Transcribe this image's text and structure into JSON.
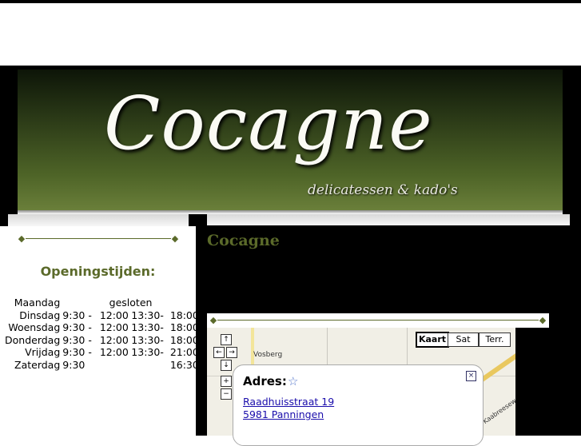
{
  "header": {
    "logo_text": "Cocagne",
    "tagline": "delicatessen & kado's"
  },
  "sidebar": {
    "hours_title": "Openingstijden:",
    "hours": [
      {
        "day": "Maandag",
        "closed": "gesloten"
      },
      {
        "day": "Dinsdag",
        "am_open": "9:30 -",
        "am_close": "12:00",
        "pm_open": "13:30-",
        "pm_close": "18:00"
      },
      {
        "day": "Woensdag",
        "am_open": "9:30 -",
        "am_close": "12:00",
        "pm_open": "13:30-",
        "pm_close": "18:00"
      },
      {
        "day": "Donderdag",
        "am_open": "9:30 -",
        "am_close": "12:00",
        "pm_open": "13:30-",
        "pm_close": "18:00"
      },
      {
        "day": "Vrijdag",
        "am_open": "9:30 -",
        "am_close": "12:00",
        "pm_open": "13:30-",
        "pm_close": "21:00"
      },
      {
        "day": "Zaterdag",
        "am_open": "9:30",
        "am_close": "",
        "pm_open": "",
        "pm_close": "16:30"
      }
    ]
  },
  "main": {
    "title": "Cocagne"
  },
  "map": {
    "types": [
      "Kaart",
      "Sat",
      "Terr."
    ],
    "active_type": "Kaart",
    "place_label": "Vosberg",
    "road_label": "Kaabreesew",
    "controls": {
      "up": "↑",
      "left": "←",
      "right": "→",
      "down": "↓",
      "zoom_in": "+",
      "zoom_out": "−"
    },
    "info_window": {
      "title": "Adres:",
      "star": "☆",
      "close": "×",
      "street": "Raadhuisstraat 19",
      "city": "5981 Panningen"
    }
  },
  "ornament": {
    "left": "◆",
    "right": "◆"
  },
  "colors": {
    "accent": "#5b6a2a",
    "background": "#000000",
    "link": "#1a0dab"
  }
}
